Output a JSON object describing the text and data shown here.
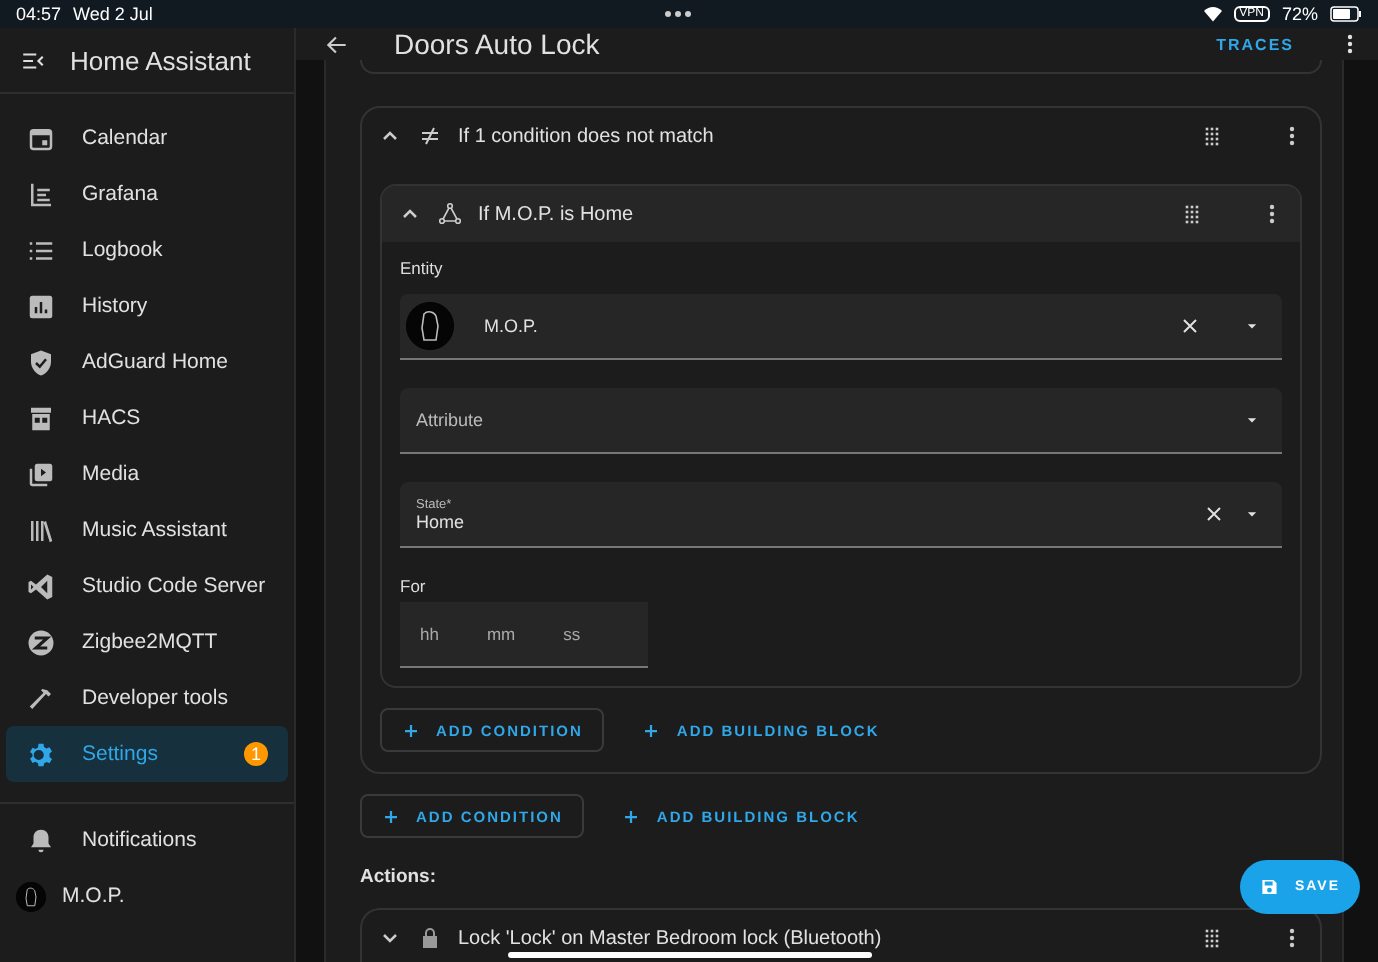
{
  "status_bar": {
    "time": "04:57",
    "date": "Wed 2 Jul",
    "vpn": "VPN",
    "battery": "72%"
  },
  "sidebar": {
    "title": "Home Assistant",
    "items": [
      {
        "label": "Calendar",
        "selected": false
      },
      {
        "label": "Grafana",
        "selected": false
      },
      {
        "label": "Logbook",
        "selected": false
      },
      {
        "label": "History",
        "selected": false
      },
      {
        "label": "AdGuard Home",
        "selected": false
      },
      {
        "label": "HACS",
        "selected": false
      },
      {
        "label": "Media",
        "selected": false
      },
      {
        "label": "Music Assistant",
        "selected": false
      },
      {
        "label": "Studio Code Server",
        "selected": false
      },
      {
        "label": "Zigbee2MQTT",
        "selected": false
      },
      {
        "label": "Developer tools",
        "selected": false
      },
      {
        "label": "Settings",
        "selected": true,
        "badge": "1"
      }
    ],
    "bottom_items": [
      {
        "label": "Notifications"
      },
      {
        "label": "M.O.P."
      }
    ]
  },
  "header": {
    "title": "Doors Auto Lock",
    "action": "TRACES"
  },
  "condition": {
    "title": "If 1 condition does not match",
    "expanded": true,
    "inner": {
      "title": "If M.O.P. is Home",
      "expanded": true,
      "entity_label": "Entity",
      "entity": {
        "value": "M.O.P."
      },
      "attribute": {
        "placeholder": "Attribute"
      },
      "state": {
        "label": "State*",
        "value": "Home"
      },
      "for_label": "For",
      "duration": [
        "hh",
        "mm",
        "ss"
      ]
    },
    "buttons": [
      "ADD CONDITION",
      "ADD BUILDING BLOCK"
    ]
  },
  "buttons": [
    "ADD CONDITION",
    "ADD BUILDING BLOCK"
  ],
  "actions_label": "Actions:",
  "actions": [
    {
      "title": "Lock 'Lock' on Master Bedroom lock (Bluetooth)",
      "expanded": false
    }
  ],
  "save": "SAVE"
}
